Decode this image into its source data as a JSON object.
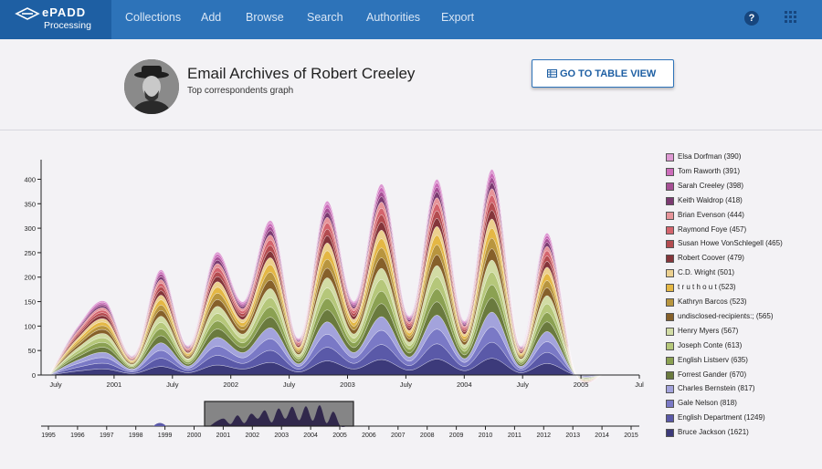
{
  "brand": {
    "name": "ePADD",
    "sub": "Processing"
  },
  "nav": {
    "items": [
      "Collections",
      "Add",
      "Browse",
      "Search",
      "Authorities",
      "Export"
    ]
  },
  "header": {
    "title": "Email Archives of Robert Creeley",
    "subtitle": "Top correspondents graph",
    "button_label": "GO TO TABLE VIEW"
  },
  "icons": {
    "help": "help-icon",
    "apps": "apps-grid-icon",
    "table": "table-icon",
    "logo": "epadd-logo-icon",
    "avatar": "photo-avatar"
  },
  "colors": {
    "nav": "#2d73b9",
    "brand": "#1e5fa3",
    "background": "#f3f2f5"
  },
  "chart_data": [
    {
      "type": "area",
      "stacked": true,
      "x": [
        "2000-07",
        "2000-10",
        "2001-01",
        "2001-04",
        "2001-07",
        "2001-10",
        "2002-01",
        "2002-04",
        "2002-07",
        "2002-10",
        "2003-01",
        "2003-04",
        "2003-07",
        "2003-10",
        "2004-01",
        "2004-04",
        "2004-07",
        "2004-10",
        "2005-01",
        "2005-04",
        "2005-07"
      ],
      "xticks": [
        "July",
        "2001",
        "April",
        "July",
        "October",
        "2002",
        "April",
        "July",
        "October",
        "2003",
        "April",
        "July",
        "October",
        "2004",
        "April",
        "July",
        "October",
        "2005",
        "April",
        "July"
      ],
      "xtick_labels": [
        "July",
        "2001",
        "July",
        "2002",
        "July",
        "2003",
        "July",
        "2004",
        "July",
        "2005",
        "Jul"
      ],
      "yticks": [
        0,
        50,
        100,
        150,
        200,
        250,
        300,
        350,
        400
      ],
      "ylim": [
        0,
        440
      ],
      "totals": [
        5,
        100,
        150,
        40,
        215,
        60,
        250,
        150,
        315,
        75,
        355,
        150,
        390,
        120,
        400,
        110,
        420,
        60,
        290,
        5,
        0
      ],
      "series": [
        {
          "name": "Bruce Jackson (1621)",
          "color": "#3c3a7a"
        },
        {
          "name": "English Department (1249)",
          "color": "#5a59a8"
        },
        {
          "name": "Gale Nelson (818)",
          "color": "#7a79c6"
        },
        {
          "name": "Charles Bernstein (817)",
          "color": "#a3a3dc"
        },
        {
          "name": "Forrest Gander (670)",
          "color": "#6a7a3e"
        },
        {
          "name": "English Listserv (635)",
          "color": "#8ba152"
        },
        {
          "name": "Joseph Conte (613)",
          "color": "#b5c77a"
        },
        {
          "name": "Henry Myers (567)",
          "color": "#d2dca5"
        },
        {
          "name": "undisclosed-recipients:; (565)",
          "color": "#86602a"
        },
        {
          "name": "Kathryn Barcos (523)",
          "color": "#b8953e"
        },
        {
          "name": "t r u t h o u t (523)",
          "color": "#e4b744"
        },
        {
          "name": "C.D. Wright (501)",
          "color": "#ecd08f"
        },
        {
          "name": "Robert Coover (479)",
          "color": "#84353a"
        },
        {
          "name": "Susan Howe VonSchlegell (465)",
          "color": "#b34b4f"
        },
        {
          "name": "Raymond Foye (457)",
          "color": "#d4646d"
        },
        {
          "name": "Brian Evenson (444)",
          "color": "#e69499"
        },
        {
          "name": "Keith Waldrop (418)",
          "color": "#7b3a71"
        },
        {
          "name": "Sarah Creeley (398)",
          "color": "#a64f95"
        },
        {
          "name": "Tom Raworth (391)",
          "color": "#cc6cba"
        },
        {
          "name": "Elsa Dorfman (390)",
          "color": "#dd99d2"
        }
      ]
    },
    {
      "type": "area",
      "role": "overview-brush",
      "xtick_labels": [
        "1995",
        "1996",
        "1997",
        "1998",
        "1999",
        "2000",
        "2001",
        "2002",
        "2003",
        "2004",
        "2005",
        "2006",
        "2007",
        "2008",
        "2009",
        "2010",
        "2011",
        "2012",
        "2013",
        "2014",
        "2015"
      ],
      "brush_range": [
        "2000-07",
        "2005-07"
      ]
    }
  ]
}
